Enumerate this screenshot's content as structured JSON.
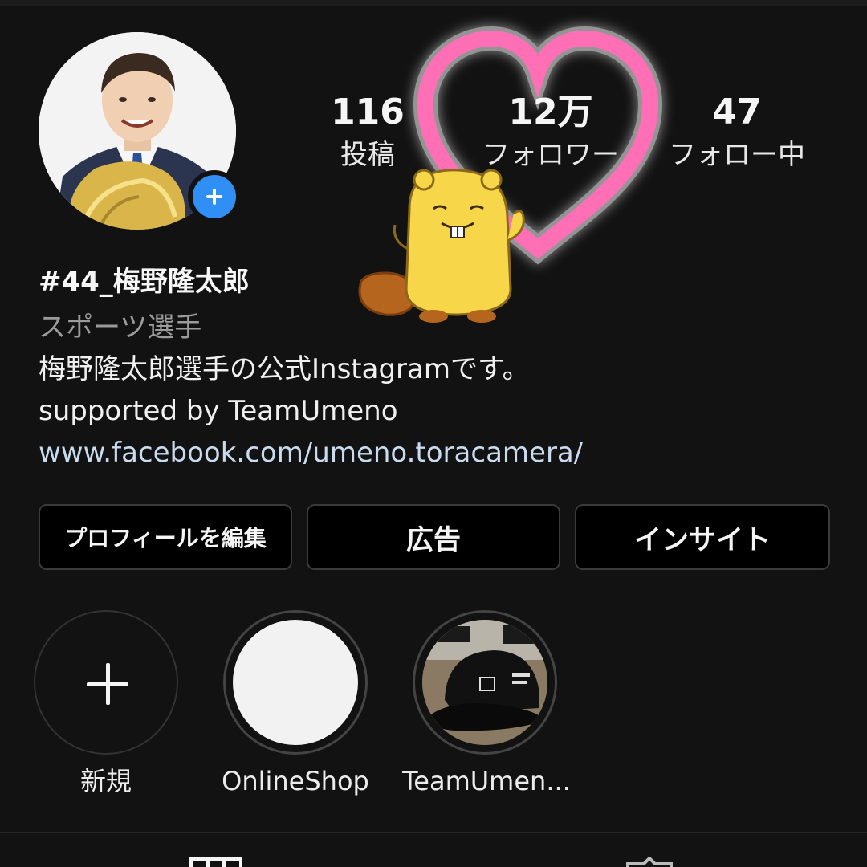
{
  "profile": {
    "posts_count": "116",
    "posts_label": "投稿",
    "followers_count": "12万",
    "followers_label": "フォロワー",
    "following_count": "47",
    "following_label": "フォロー中",
    "name": "#44_梅野隆太郎",
    "category": "スポーツ選手",
    "bio_line1": "梅野隆太郎選手の公式Instagramです。",
    "bio_line2": "supported by TeamUmeno",
    "link": "www.facebook.com/umeno.toracamera/"
  },
  "buttons": {
    "edit_profile": "プロフィールを編集",
    "ads": "広告",
    "insights": "インサイト"
  },
  "highlights": [
    {
      "label": "新規",
      "icon": "plus-icon"
    },
    {
      "label": "OnlineShop"
    },
    {
      "label": "TeamUmen..."
    }
  ],
  "tabs": [
    {
      "icon": "grid-icon"
    },
    {
      "icon": "tagged-icon"
    }
  ],
  "colors": {
    "background": "#121212",
    "badge": "#2f8ff5",
    "heart_sticker": "#ff6fb5",
    "beaver_sticker": "#f7d64a",
    "link": "#c9dbef",
    "secondary_text": "#9b9b9b"
  }
}
